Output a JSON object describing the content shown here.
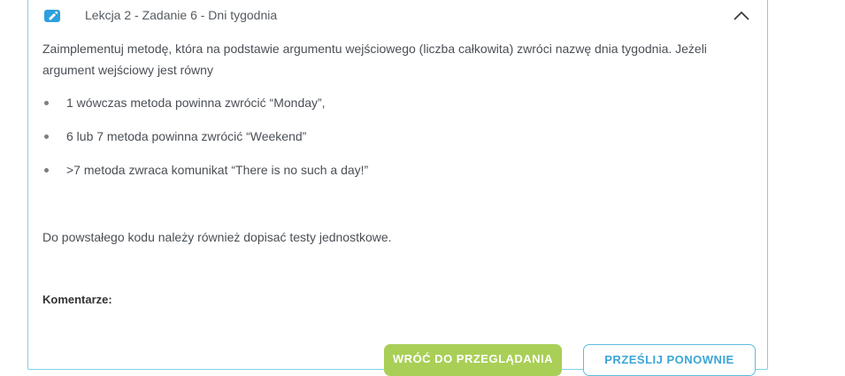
{
  "task": {
    "title": "Lekcja 2 - Zadanie 6 - Dni tygodnia",
    "icon": "edit-task-icon",
    "collapse_icon": "chevron-up-icon"
  },
  "content": {
    "intro": "Zaimplementuj metodę, która na podstawie argumentu wejściowego (liczba całkowita) zwróci nazwę dnia tygodnia. Jeżeli argument wejściowy jest równy",
    "bullets": [
      "1 wówczas metoda powinna zwrócić “Monday”,",
      "6 lub 7 metoda powinna zwrócić “Weekend”",
      ">7 metoda zwraca komunikat “There is no such a day!”"
    ],
    "outro": "Do powstałego kodu należy również dopisać testy jednostkowe.",
    "comments_label": "Komentarze:"
  },
  "buttons": {
    "primary_label": "WRÓĆ DO PRZEGLĄDANIA",
    "secondary_label": "PRZEŚLIJ PONOWNIE"
  },
  "colors": {
    "accent": "#2d9fe0",
    "border": "#7fd0e8",
    "primary_button": "#a9cf57",
    "secondary_button_text": "#3aa6d6"
  }
}
